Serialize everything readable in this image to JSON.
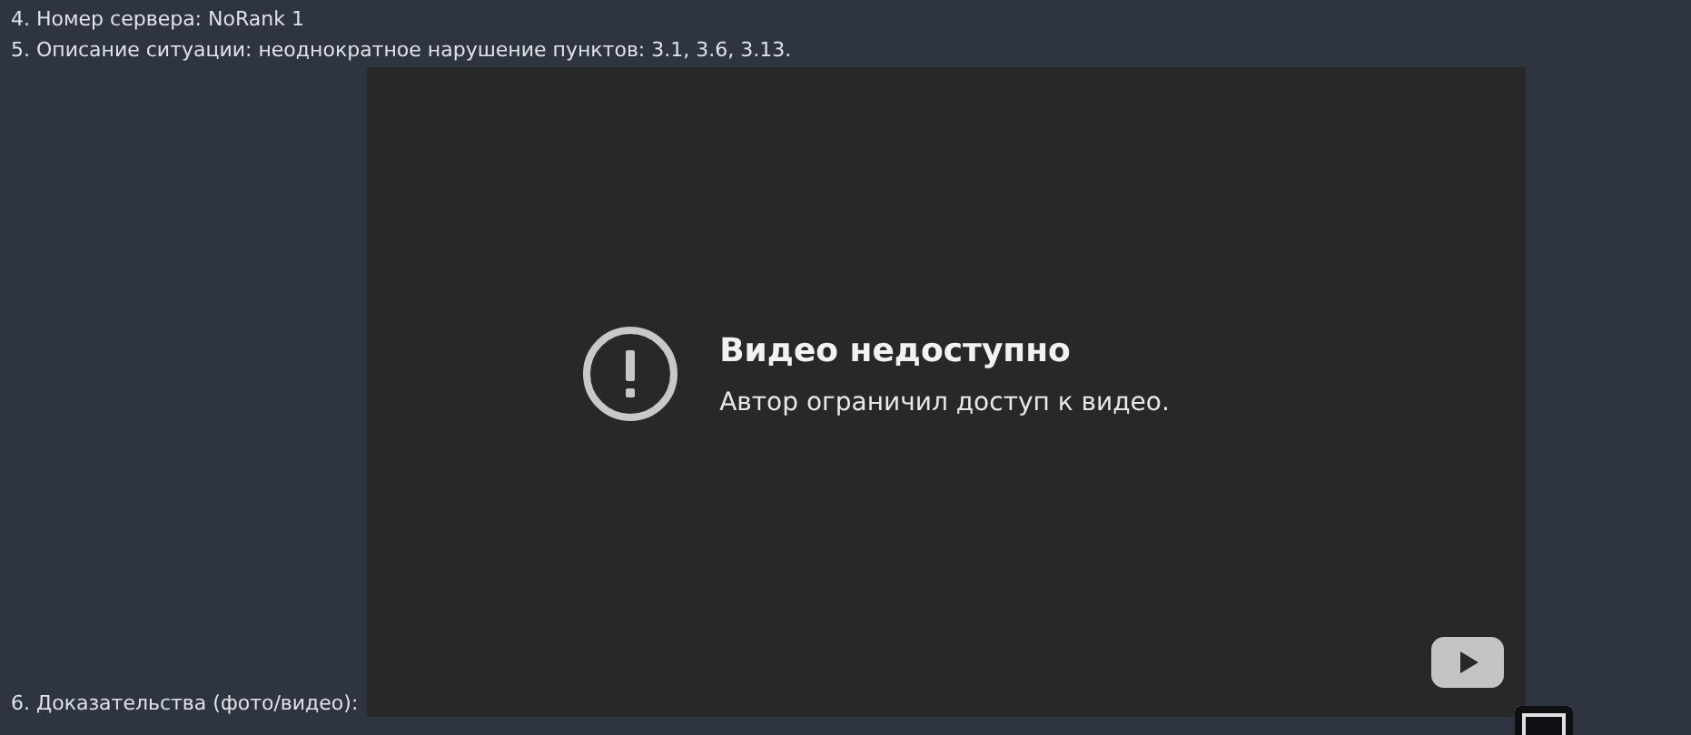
{
  "lines": [
    "4. Номер сервера: NoRank 1",
    "5. Описание ситуации: неоднократное нарушение пунктов: 3.1, 3.6, 3.13."
  ],
  "video": {
    "title": "Видео недоступно",
    "message": "Автор ограничил доступ к видео."
  },
  "evidence_label": "6. Доказательства (фото/видео):"
}
